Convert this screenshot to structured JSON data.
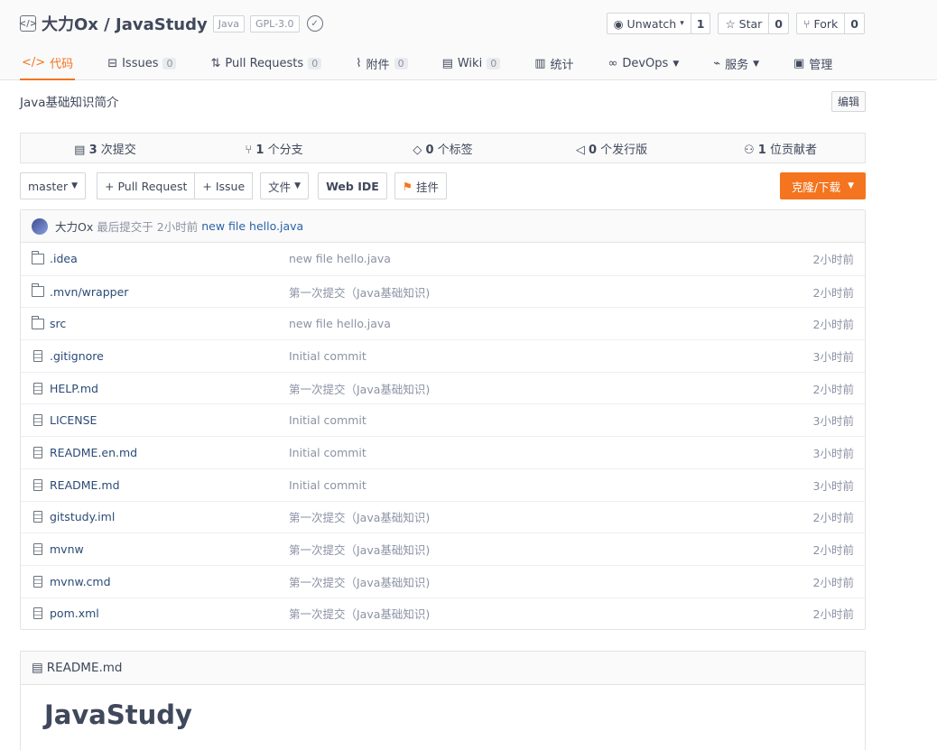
{
  "repo": {
    "title": "大力Ox / JavaStudy",
    "language_tag": "Java",
    "license_tag": "GPL-3.0"
  },
  "actions": {
    "watch_label": "Unwatch",
    "watch_count": "1",
    "star_label": "Star",
    "star_count": "0",
    "fork_label": "Fork",
    "fork_count": "0"
  },
  "tabs": [
    {
      "label": "代码",
      "count": null,
      "icon": "code-icon",
      "active": true
    },
    {
      "label": "Issues",
      "count": "0",
      "icon": "issues-icon"
    },
    {
      "label": "Pull Requests",
      "count": "0",
      "icon": "pull-request-icon"
    },
    {
      "label": "附件",
      "count": "0",
      "icon": "attachment-icon"
    },
    {
      "label": "Wiki",
      "count": "0",
      "icon": "wiki-icon"
    },
    {
      "label": "统计",
      "count": null,
      "icon": "stats-icon"
    },
    {
      "label": "DevOps",
      "count": null,
      "icon": "devops-icon"
    },
    {
      "label": "服务",
      "count": null,
      "icon": "service-icon"
    },
    {
      "label": "管理",
      "count": null,
      "icon": "manage-icon"
    }
  ],
  "description": "Java基础知识简介",
  "edit_label": "编辑",
  "stats": {
    "commits_count": "3",
    "commits_label": "次提交",
    "branches_count": "1",
    "branches_label": "个分支",
    "tags_count": "0",
    "tags_label": "个标签",
    "releases_count": "0",
    "releases_label": "个发行版",
    "contributors_count": "1",
    "contributors_label": "位贡献者"
  },
  "toolbar": {
    "branch": "master",
    "pull_request": "+ Pull Request",
    "issue": "+ Issue",
    "files": "文件",
    "web_ide": "Web IDE",
    "pendant": "挂件",
    "clone": "克隆/下载"
  },
  "last_commit": {
    "author": "大力Ox",
    "prefix": "最后提交于",
    "time": "2小时前",
    "message": "new file hello.java"
  },
  "files": [
    {
      "name": ".idea",
      "type": "folder",
      "message": "new file hello.java",
      "time": "2小时前"
    },
    {
      "name": ".mvn/wrapper",
      "type": "folder",
      "message": "第一次提交（Java基础知识)",
      "time": "2小时前"
    },
    {
      "name": "src",
      "type": "folder",
      "message": "new file hello.java",
      "time": "2小时前"
    },
    {
      "name": ".gitignore",
      "type": "file",
      "message": "Initial commit",
      "time": "3小时前"
    },
    {
      "name": "HELP.md",
      "type": "file",
      "message": "第一次提交（Java基础知识)",
      "time": "2小时前"
    },
    {
      "name": "LICENSE",
      "type": "file",
      "message": "Initial commit",
      "time": "3小时前"
    },
    {
      "name": "README.en.md",
      "type": "file",
      "message": "Initial commit",
      "time": "3小时前"
    },
    {
      "name": "README.md",
      "type": "file",
      "message": "Initial commit",
      "time": "3小时前"
    },
    {
      "name": "gitstudy.iml",
      "type": "file",
      "message": "第一次提交（Java基础知识)",
      "time": "2小时前"
    },
    {
      "name": "mvnw",
      "type": "file",
      "message": "第一次提交（Java基础知识)",
      "time": "2小时前"
    },
    {
      "name": "mvnw.cmd",
      "type": "file",
      "message": "第一次提交（Java基础知识)",
      "time": "2小时前"
    },
    {
      "name": "pom.xml",
      "type": "file",
      "message": "第一次提交（Java基础知识)",
      "time": "2小时前"
    }
  ],
  "readme": {
    "filename": "README.md",
    "heading": "JavaStudy"
  },
  "colors": {
    "accent": "#f4741f",
    "link": "#2b62a8"
  }
}
